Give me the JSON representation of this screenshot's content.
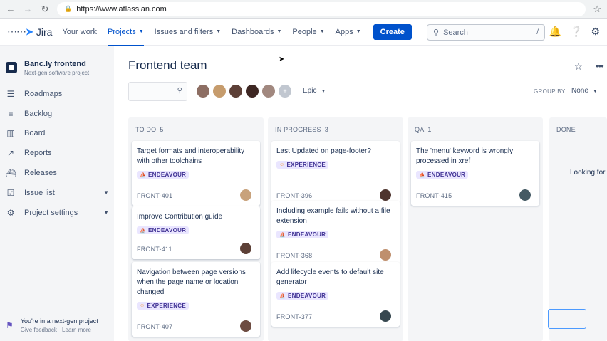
{
  "browser": {
    "url": "https://www.atlassian.com"
  },
  "topnav": {
    "logo_text": "Jira",
    "items": [
      {
        "label": "Your work",
        "dropdown": false,
        "active": false
      },
      {
        "label": "Projects",
        "dropdown": true,
        "active": true
      },
      {
        "label": "Issues and filters",
        "dropdown": true,
        "active": false
      },
      {
        "label": "Dashboards",
        "dropdown": true,
        "active": false
      },
      {
        "label": "People",
        "dropdown": true,
        "active": false
      },
      {
        "label": "Apps",
        "dropdown": true,
        "active": false
      }
    ],
    "create_label": "Create",
    "search_placeholder": "Search",
    "search_shortcut": "/"
  },
  "sidebar": {
    "project_name": "Banc.ly frontend",
    "project_type": "Next-gen software project",
    "items": [
      {
        "label": "Roadmaps",
        "icon": "roadmap-icon",
        "expand": false
      },
      {
        "label": "Backlog",
        "icon": "backlog-icon",
        "expand": false
      },
      {
        "label": "Board",
        "icon": "board-icon",
        "expand": false
      },
      {
        "label": "Reports",
        "icon": "reports-icon",
        "expand": false
      },
      {
        "label": "Releases",
        "icon": "releases-icon",
        "expand": false
      },
      {
        "label": "Issue list",
        "icon": "issue-list-icon",
        "expand": true
      },
      {
        "label": "Project settings",
        "icon": "gear-icon",
        "expand": true
      }
    ],
    "footer_line1": "You're in a next-gen project",
    "footer_feedback": "Give feedback",
    "footer_sep": "·",
    "footer_learn": "Learn more"
  },
  "board": {
    "title": "Frontend team",
    "epic_label": "Epic",
    "groupby_label": "GROUP BY",
    "groupby_value": "None",
    "avatars": [
      "#8d6e63",
      "#c69c6d",
      "#5d4037",
      "#3e2723",
      "#a1887f"
    ],
    "looking_text": "Looking for",
    "columns": [
      {
        "name": "TO DO",
        "count": "5",
        "cards": [
          {
            "title": "Target formats and interoperability with other toolchains",
            "tag": "ENDEAVOUR",
            "tag_type": "endeavour",
            "key": "FRONT-401",
            "avatar": "#c8a27c"
          },
          {
            "title": "Improve Contribution guide",
            "tag": "ENDEAVOUR",
            "tag_type": "endeavour",
            "key": "FRONT-411",
            "avatar": "#5d4037"
          },
          {
            "title": "Navigation between page versions when the page name or location changed",
            "tag": "EXPERIENCE",
            "tag_type": "experience",
            "key": "FRONT-407",
            "avatar": "#6d4c41"
          }
        ]
      },
      {
        "name": "IN PROGRESS",
        "count": "3",
        "cards": [
          {
            "title": "Last Updated on page-footer?",
            "tag": "EXPERIENCE",
            "tag_type": "experience",
            "key": "FRONT-396",
            "avatar": "#4e342e"
          },
          {
            "title": "Including example fails without a file extension",
            "tag": "ENDEAVOUR",
            "tag_type": "endeavour",
            "key": "FRONT-368",
            "avatar": "#bf8f6d"
          },
          {
            "title": "Add lifecycle events to default site generator",
            "tag": "ENDEAVOUR",
            "tag_type": "endeavour",
            "key": "FRONT-377",
            "avatar": "#37474f"
          }
        ]
      },
      {
        "name": "QA",
        "count": "1",
        "cards": [
          {
            "title": "The 'menu' keyword is wrongly processed in xref",
            "tag": "ENDEAVOUR",
            "tag_type": "endeavour",
            "key": "FRONT-415",
            "avatar": "#455a64"
          }
        ]
      },
      {
        "name": "DONE",
        "count": "",
        "cards": []
      }
    ]
  },
  "colors": {
    "brand": "#0052cc",
    "tag_bg": "#eae6ff",
    "tag_fg": "#403294"
  }
}
